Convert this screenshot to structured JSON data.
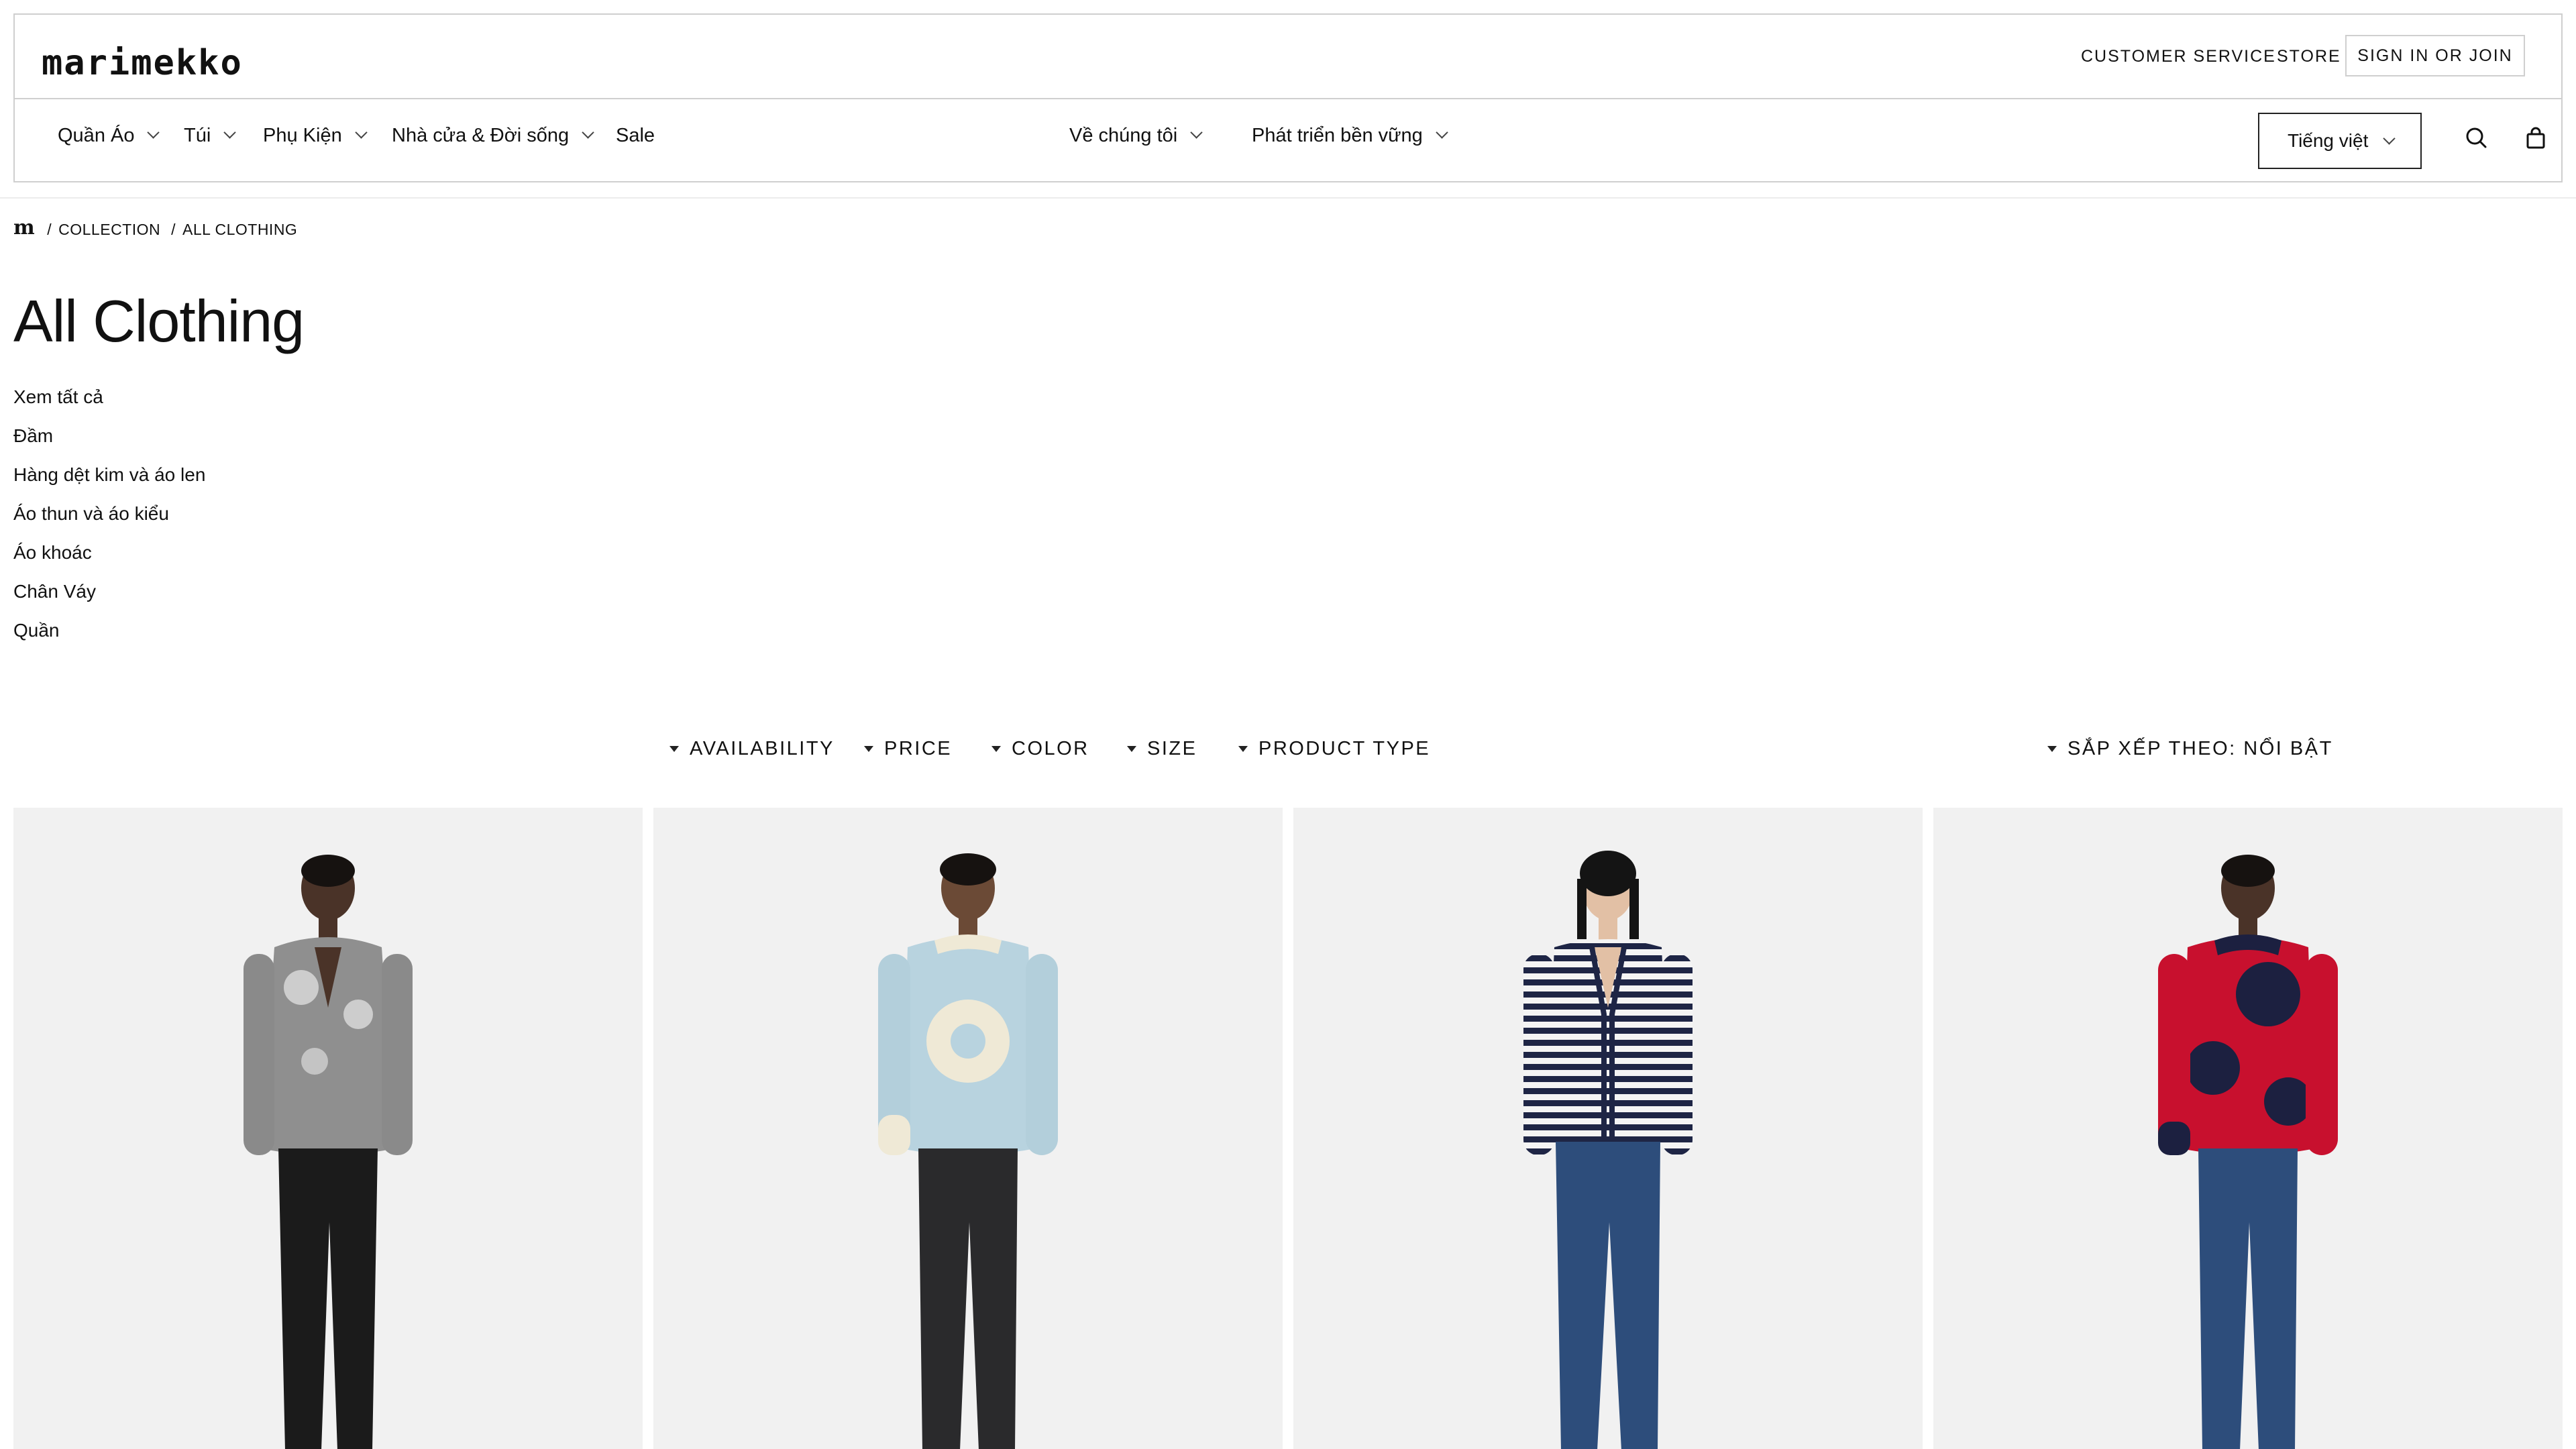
{
  "header": {
    "logo": "marimekko",
    "utility": {
      "customer_service": "CUSTOMER SERVICE",
      "store": "STORE",
      "sign_in": "SIGN IN OR JOIN"
    },
    "nav_left": [
      {
        "label": "Quần Áo"
      },
      {
        "label": "Túi"
      },
      {
        "label": "Phụ Kiện"
      },
      {
        "label": "Nhà cửa & Đời sống"
      },
      {
        "label": "Sale"
      }
    ],
    "nav_center": [
      {
        "label": "Về chúng tôi"
      },
      {
        "label": "Phát triển bền vững"
      }
    ],
    "language": "Tiếng việt",
    "icons": [
      "search-icon",
      "bag-icon",
      "chevron-down-icon"
    ]
  },
  "breadcrumb": {
    "home_glyph": "m",
    "items": [
      "COLLECTION",
      "ALL CLOTHING"
    ]
  },
  "page": {
    "title": "All Clothing",
    "categories": [
      "Xem tất cả",
      "Đầm",
      "Hàng dệt kim và áo len",
      "Áo thun và áo kiểu",
      "Áo khoác",
      "Chân Váy",
      "Quần"
    ]
  },
  "filters": {
    "items": [
      "AVAILABILITY",
      "PRICE",
      "COLOR",
      "SIZE",
      "PRODUCT TYPE"
    ],
    "sort": "SẮP XẾP THEO: NỔI BẬT"
  },
  "products": [
    {
      "image": "model-grey-floral-cardigan-black-trousers"
    },
    {
      "image": "model-light-blue-sweater-white-circle-black-jeans"
    },
    {
      "image": "model-navy-white-striped-cardigan-blue-jeans"
    },
    {
      "image": "model-red-navy-unikko-sweater-blue-jeans"
    }
  ],
  "colors": {
    "border": "#cfcfcf",
    "text": "#111111",
    "card_bg": "#f1f1f1"
  }
}
